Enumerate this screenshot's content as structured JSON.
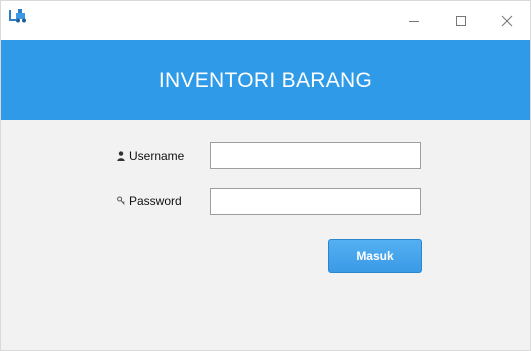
{
  "window": {
    "minimize_glyph": "—",
    "maximize_glyph": "☐",
    "close_glyph": "✕"
  },
  "banner": {
    "title": "INVENTORI BARANG",
    "color": "#2f9be8"
  },
  "form": {
    "username_label": "Username",
    "username_value": "",
    "password_label": "Password",
    "password_value": "",
    "submit_label": "Masuk"
  },
  "icons": {
    "app": "app-forklift-icon",
    "username": "person-icon",
    "password": "key-icon"
  }
}
